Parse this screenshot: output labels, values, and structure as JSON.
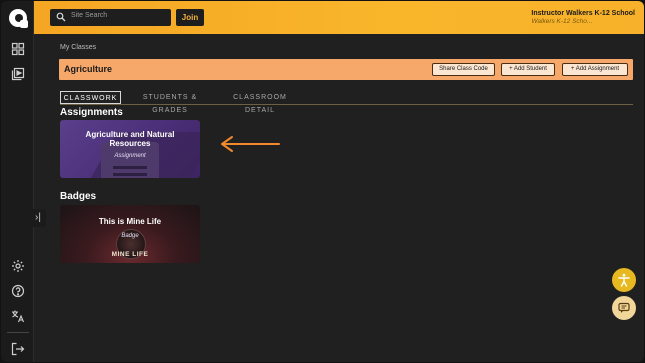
{
  "header": {
    "search_placeholder": "Site Search",
    "join_label": "Join",
    "user_name": "Instructor Walkers K-12 School",
    "school_name": "Walkers K-12 Scho..."
  },
  "breadcrumb": "My Classes",
  "class_bar": {
    "title": "Agriculture",
    "share_label": "Share Class Code",
    "add_student_label": "+ Add Student",
    "add_assignment_label": "+ Add Assignment"
  },
  "tabs": [
    {
      "label": "CLASSWORK",
      "active": true
    },
    {
      "label": "STUDENTS & GRADES",
      "active": false
    },
    {
      "label": "CLASSROOM DETAIL",
      "active": false
    }
  ],
  "assignments": {
    "heading": "Assignments",
    "card_title": "Agriculture and Natural Resources",
    "card_type": "Assignment"
  },
  "badges": {
    "heading": "Badges",
    "card_title": "This is Mine Life",
    "card_type": "Badge",
    "emblem_text": "MINE LIFE"
  },
  "colors": {
    "header_accent": "#f9b62b",
    "class_bar": "#f6a86b",
    "arrow": "#f08a2c",
    "accessibility_button": "#e8b820"
  },
  "icons": {
    "sidebar_top": [
      "dashboard-icon",
      "library-icon"
    ],
    "sidebar_bottom": [
      "settings-icon",
      "help-icon",
      "translate-icon",
      "logout-icon"
    ],
    "collapse": "expand-sidebar-icon",
    "floating": [
      "accessibility-icon",
      "chat-icon"
    ]
  }
}
